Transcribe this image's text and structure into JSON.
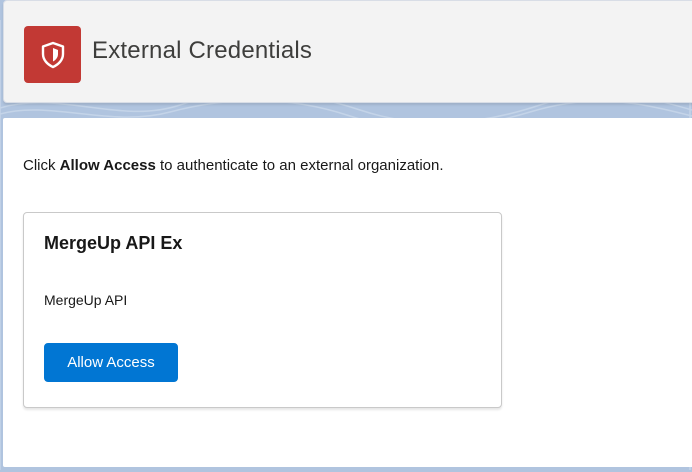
{
  "header": {
    "title": "External Credentials",
    "icon": "shield-icon",
    "icon_color": "#c23934"
  },
  "instruction": {
    "prefix": "Click ",
    "bold": "Allow Access",
    "suffix": " to authenticate to an external organization."
  },
  "card": {
    "title": "MergeUp API Ex",
    "description": "MergeUp API",
    "button_label": "Allow Access",
    "button_color": "#0176d3"
  }
}
